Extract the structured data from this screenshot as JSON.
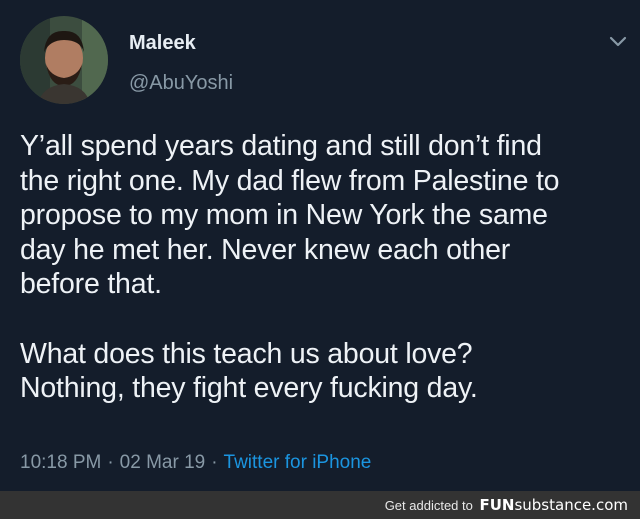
{
  "tweet": {
    "display_name": "Maleek",
    "handle": "@AbuYoshi",
    "body_lines_p1": [
      "Y’all spend years dating and still don’t find",
      "the right one. My dad flew from Palestine to",
      "propose to my mom in New York the same",
      "day he met her. Never knew each other",
      "before that."
    ],
    "body_lines_p2": [
      "What does this teach us about love?",
      "Nothing, they fight every fucking day."
    ],
    "time": "10:18 PM",
    "date": "02 Mar 19",
    "source": "Twitter for iPhone",
    "separator": "·",
    "menu_icon": "chevron-down-icon",
    "colors": {
      "background": "#141d2b",
      "text": "#eef2f6",
      "muted": "#8899a6",
      "link": "#1b95e0"
    }
  },
  "footer": {
    "text": "Get addicted to",
    "logo_fun": "FUN",
    "logo_rest": "substance.com"
  }
}
